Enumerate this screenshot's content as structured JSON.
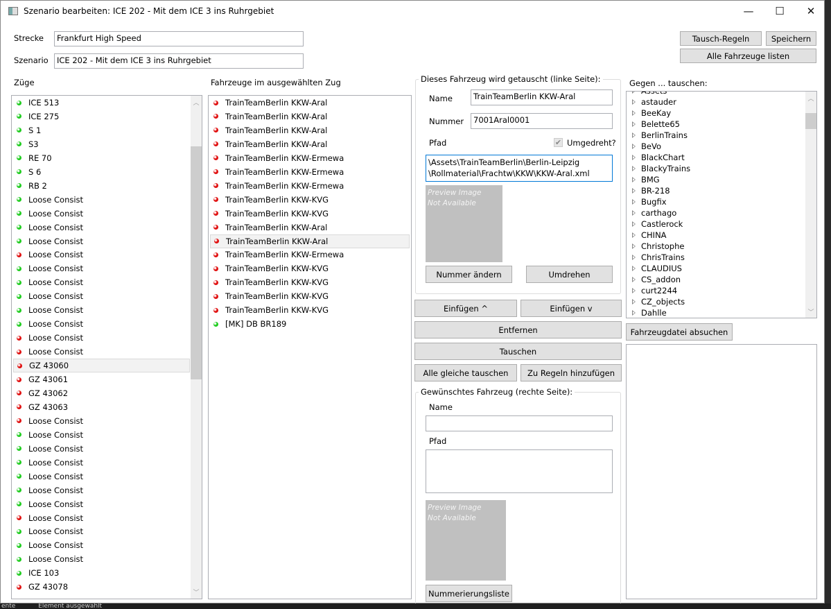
{
  "window": {
    "title": "Szenario bearbeiten: ICE 202 - Mit dem ICE 3 ins Ruhrgebiet",
    "minimize": "—",
    "maximize": "☐",
    "close": "✕"
  },
  "header": {
    "strecke_label": "Strecke",
    "strecke_value": "Frankfurt High Speed",
    "szenario_label": "Szenario",
    "szenario_value": "ICE 202 - Mit dem ICE 3 ins Ruhrgebiet",
    "tausch_regeln": "Tausch-Regeln",
    "speichern": "Speichern",
    "alle_fahrzeuge": "Alle Fahrzeuge listen"
  },
  "colors": {
    "green": "#1fcc1f",
    "red": "#e01010",
    "accent": "#0078d7"
  },
  "trains": {
    "label": "Züge",
    "selected_index": 19,
    "items": [
      {
        "name": "ICE 513",
        "status": "green"
      },
      {
        "name": "ICE 275",
        "status": "green"
      },
      {
        "name": "S 1",
        "status": "green"
      },
      {
        "name": "S3",
        "status": "green"
      },
      {
        "name": "RE 70",
        "status": "green"
      },
      {
        "name": "S 6",
        "status": "green"
      },
      {
        "name": "RB 2",
        "status": "green"
      },
      {
        "name": "Loose Consist",
        "status": "green"
      },
      {
        "name": "Loose Consist",
        "status": "green"
      },
      {
        "name": "Loose Consist",
        "status": "green"
      },
      {
        "name": "Loose Consist",
        "status": "green"
      },
      {
        "name": "Loose Consist",
        "status": "red"
      },
      {
        "name": "Loose Consist",
        "status": "green"
      },
      {
        "name": "Loose Consist",
        "status": "green"
      },
      {
        "name": "Loose Consist",
        "status": "green"
      },
      {
        "name": "Loose Consist",
        "status": "green"
      },
      {
        "name": "Loose Consist",
        "status": "green"
      },
      {
        "name": "Loose Consist",
        "status": "red"
      },
      {
        "name": "Loose Consist",
        "status": "red"
      },
      {
        "name": "GZ 43060",
        "status": "red"
      },
      {
        "name": "GZ 43061",
        "status": "red"
      },
      {
        "name": "GZ 43062",
        "status": "red"
      },
      {
        "name": "GZ 43063",
        "status": "red"
      },
      {
        "name": "Loose Consist",
        "status": "red"
      },
      {
        "name": "Loose Consist",
        "status": "green"
      },
      {
        "name": "Loose Consist",
        "status": "green"
      },
      {
        "name": "Loose Consist",
        "status": "green"
      },
      {
        "name": "Loose Consist",
        "status": "green"
      },
      {
        "name": "Loose Consist",
        "status": "green"
      },
      {
        "name": "Loose Consist",
        "status": "green"
      },
      {
        "name": "Loose Consist",
        "status": "red"
      },
      {
        "name": "Loose Consist",
        "status": "green"
      },
      {
        "name": "Loose Consist",
        "status": "green"
      },
      {
        "name": "Loose Consist",
        "status": "green"
      },
      {
        "name": "ICE 103",
        "status": "green"
      },
      {
        "name": "GZ 43078",
        "status": "red"
      }
    ]
  },
  "vehicles": {
    "label": "Fahrzeuge im ausgewählten Zug",
    "selected_index": 10,
    "items": [
      {
        "name": "TrainTeamBerlin KKW-Aral",
        "status": "red"
      },
      {
        "name": "TrainTeamBerlin KKW-Aral",
        "status": "red"
      },
      {
        "name": "TrainTeamBerlin KKW-Aral",
        "status": "red"
      },
      {
        "name": "TrainTeamBerlin KKW-Aral",
        "status": "red"
      },
      {
        "name": "TrainTeamBerlin KKW-Ermewa",
        "status": "red"
      },
      {
        "name": "TrainTeamBerlin KKW-Ermewa",
        "status": "red"
      },
      {
        "name": "TrainTeamBerlin KKW-Ermewa",
        "status": "red"
      },
      {
        "name": "TrainTeamBerlin KKW-KVG",
        "status": "red"
      },
      {
        "name": "TrainTeamBerlin KKW-KVG",
        "status": "red"
      },
      {
        "name": "TrainTeamBerlin KKW-Aral",
        "status": "red"
      },
      {
        "name": "TrainTeamBerlin KKW-Aral",
        "status": "red"
      },
      {
        "name": "TrainTeamBerlin KKW-Ermewa",
        "status": "red"
      },
      {
        "name": "TrainTeamBerlin KKW-KVG",
        "status": "red"
      },
      {
        "name": "TrainTeamBerlin KKW-KVG",
        "status": "red"
      },
      {
        "name": "TrainTeamBerlin KKW-KVG",
        "status": "red"
      },
      {
        "name": "TrainTeamBerlin KKW-KVG",
        "status": "red"
      },
      {
        "name": "[MK] DB BR189",
        "status": "green"
      }
    ]
  },
  "left_side": {
    "title": "Dieses Fahrzeug wird getauscht (linke Seite):",
    "name_label": "Name",
    "name_value": "TrainTeamBerlin KKW-Aral",
    "nummer_label": "Nummer",
    "nummer_value": "7001Aral0001",
    "pfad_label": "Pfad",
    "umgedreht_label": "Umgedreht?",
    "umgedreht_checked": true,
    "pfad_line1": "\\Assets\\TrainTeamBerlin\\Berlin-Leipzig",
    "pfad_line2": "\\Rollmaterial\\Frachtw\\KKW\\KKW-Aral.xml",
    "preview_line1": "Preview Image",
    "preview_line2": "Not Available",
    "nummer_aendern": "Nummer ändern",
    "umdrehen": "Umdrehen"
  },
  "actions": {
    "einfuegen_up": "Einfügen ^",
    "einfuegen_down": "Einfügen v",
    "entfernen": "Entfernen",
    "tauschen": "Tauschen",
    "alle_gleiche": "Alle gleiche tauschen",
    "zu_regeln": "Zu Regeln hinzufügen"
  },
  "right_side": {
    "title": "Gewünschtes Fahrzeug (rechte Seite):",
    "name_label": "Name",
    "name_value": "",
    "pfad_label": "Pfad",
    "pfad_value": "",
    "preview_line1": "Preview Image",
    "preview_line2": "Not Available",
    "nummerierungsliste": "Nummerierungsliste"
  },
  "swap_tree": {
    "label": "Gegen ... tauschen:",
    "items": [
      "Assets",
      "astauder",
      "BeeKay",
      "Belette65",
      "BerlinTrains",
      "BeVo",
      "BlackChart",
      "BlackyTrains",
      "BMG",
      "BR-218",
      "Bugfix",
      "carthago",
      "Castlerock",
      "CHINA",
      "Christophe",
      "ChrisTrains",
      "CLAUDIUS",
      "CS_addon",
      "curt2244",
      "CZ_objects",
      "Dahlle"
    ],
    "search_button": "Fahrzeugdatei absuchen"
  },
  "background_status": {
    "left": "ente",
    "right": "Element ausgewählt"
  }
}
